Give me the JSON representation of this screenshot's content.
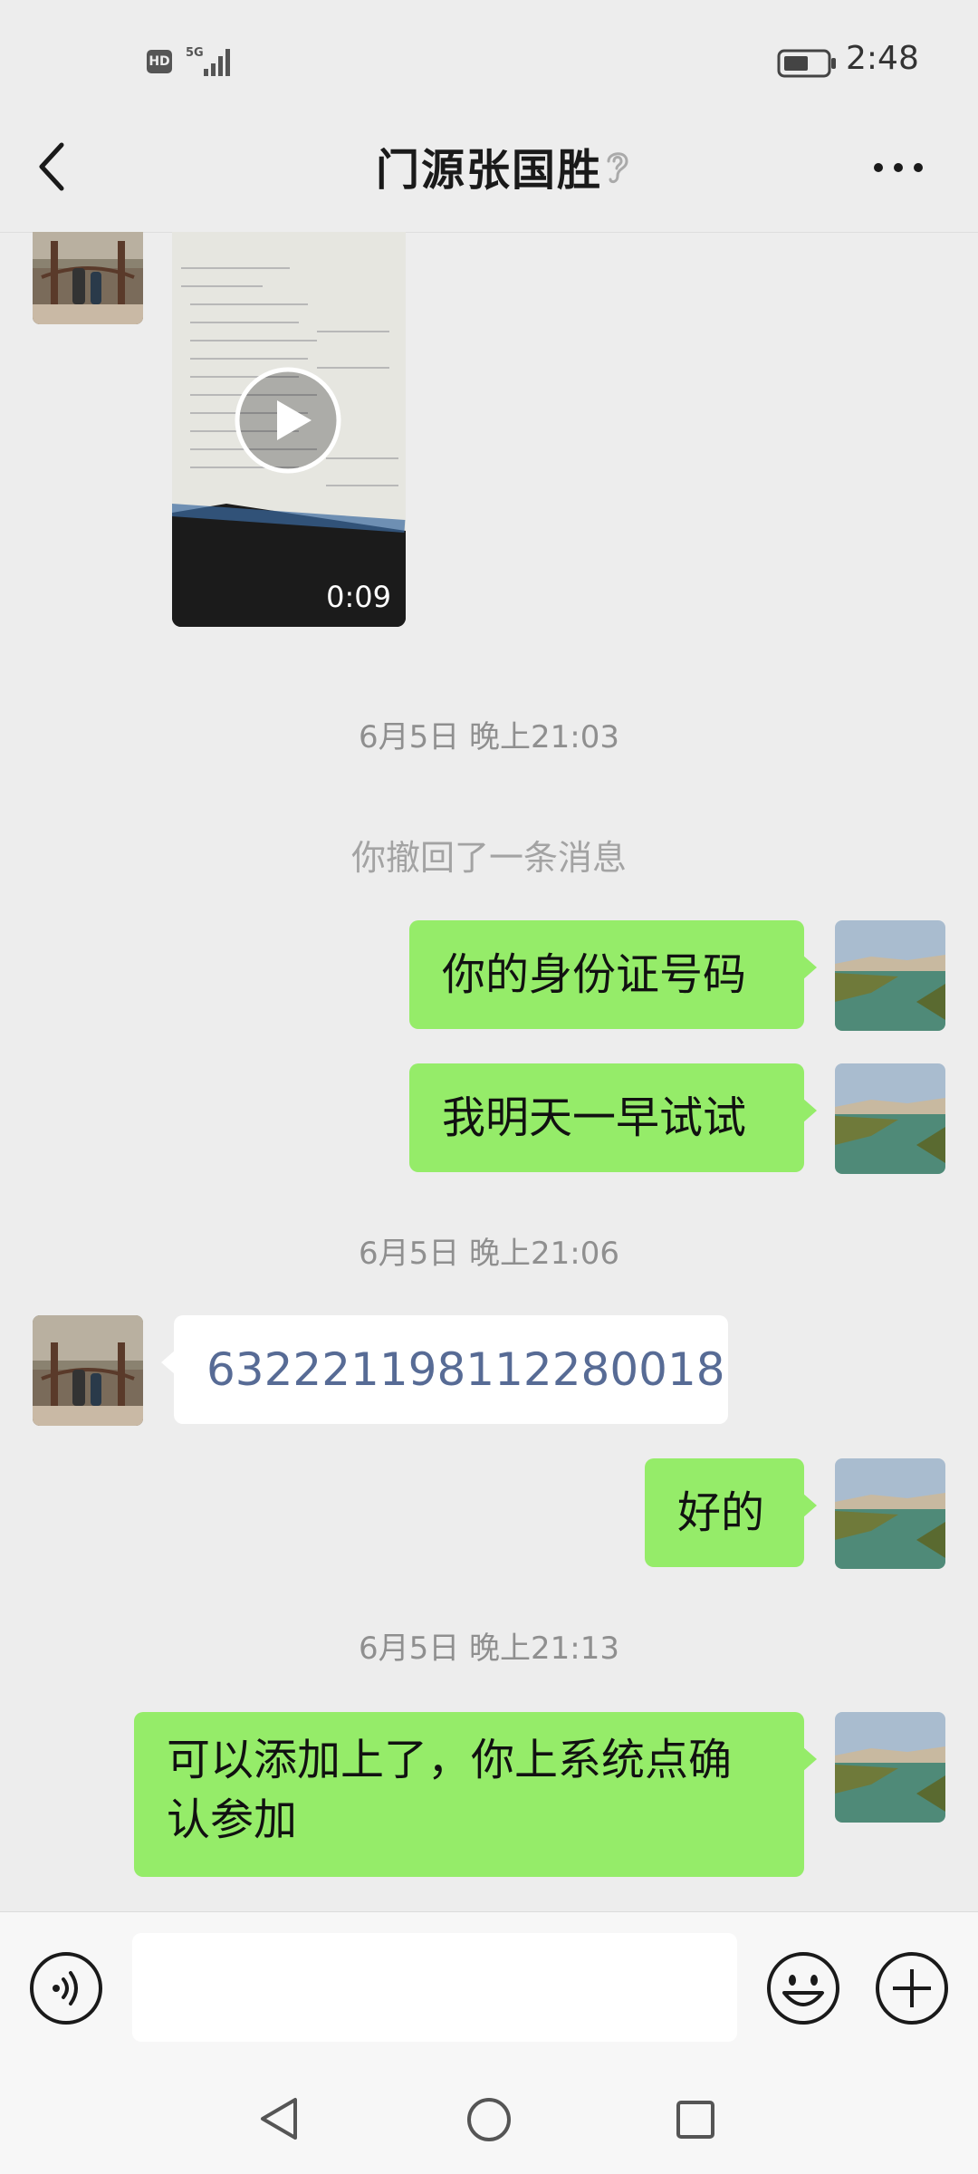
{
  "status_bar": {
    "hd_badge": "HD",
    "network": "5G",
    "time": "2:48"
  },
  "header": {
    "title": "门源张国胜",
    "back_icon": "chevron-left-icon",
    "ear_icon": "ear-icon",
    "more_icon": "more-dots-icon"
  },
  "video_message": {
    "duration": "0:09"
  },
  "messages": [
    {
      "type": "time",
      "text": "6月5日 晚上21:03"
    },
    {
      "type": "system",
      "text": "你撤回了一条消息"
    },
    {
      "type": "sent",
      "text": "你的身份证号码"
    },
    {
      "type": "sent",
      "text": "我明天一早试试"
    },
    {
      "type": "time",
      "text": "6月5日 晚上21:06"
    },
    {
      "type": "received",
      "text": "632221198112280018"
    },
    {
      "type": "sent",
      "text": "好的"
    },
    {
      "type": "time",
      "text": "6月5日 晚上21:13"
    },
    {
      "type": "sent",
      "text_line1": "可以添加上了，你上系统点确",
      "text_line2": "认参加"
    }
  ],
  "colors": {
    "background": "#ededed",
    "sent_bubble": "#95ec69",
    "received_bubble": "#ffffff",
    "id_number_text": "#576b95"
  },
  "input_bar": {
    "voice_icon": "voice-icon",
    "emoji_icon": "emoji-icon",
    "plus_icon": "plus-icon"
  },
  "nav_bar": {
    "back": "nav-back-icon",
    "home": "nav-home-icon",
    "recent": "nav-recent-icon"
  }
}
